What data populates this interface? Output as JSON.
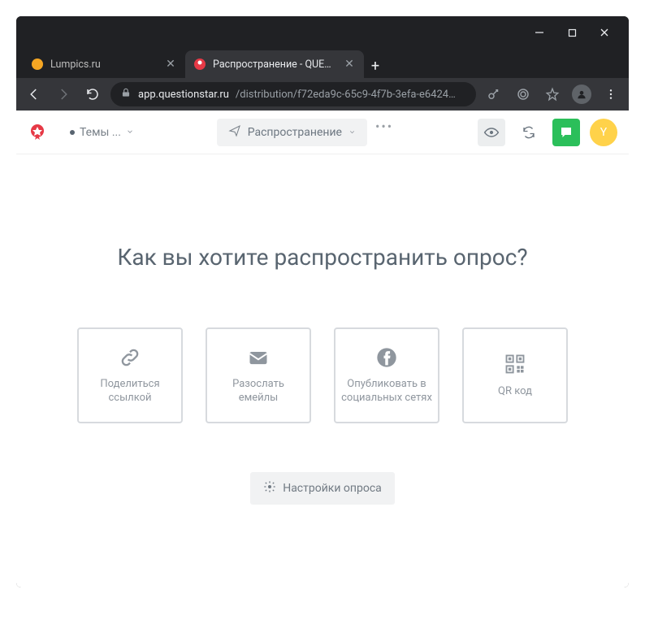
{
  "window": {
    "tabs": [
      {
        "title": "Lumpics.ru"
      },
      {
        "title": "Распространение - QUESTIONS"
      }
    ]
  },
  "browser": {
    "url_domain": "app.questionstar.ru",
    "url_path": "/distribution/f72eda9c-65c9-4f7b-3efa-e6424…"
  },
  "app_header": {
    "themes_label": "Темы ...",
    "distribution_label": "Распространение",
    "user_initial": "Y"
  },
  "main": {
    "title": "Как вы хотите распространить опрос?",
    "cards": [
      {
        "label": "Поделиться ссылкой"
      },
      {
        "label": "Разослать емейлы"
      },
      {
        "label": "Опубликовать в социальных сетях"
      },
      {
        "label": "QR код"
      }
    ],
    "settings_label": "Настройки опроса"
  }
}
